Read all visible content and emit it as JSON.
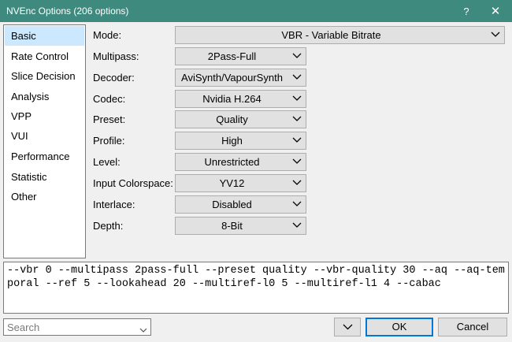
{
  "window": {
    "title": "NVEnc Options (206 options)",
    "help_glyph": "?",
    "close_glyph": "✕",
    "titlebar_color": "#3f8a7f"
  },
  "sidebar": {
    "items": [
      {
        "label": "Basic",
        "selected": true
      },
      {
        "label": "Rate Control"
      },
      {
        "label": "Slice Decision"
      },
      {
        "label": "Analysis"
      },
      {
        "label": "VPP"
      },
      {
        "label": "VUI"
      },
      {
        "label": "Performance"
      },
      {
        "label": "Statistic"
      },
      {
        "label": "Other"
      }
    ],
    "selected_color": "#cce8ff"
  },
  "options": [
    {
      "label": "Mode:",
      "value": "VBR - Variable Bitrate"
    },
    {
      "label": "Multipass:",
      "value": "2Pass-Full"
    },
    {
      "label": "Decoder:",
      "value": "AviSynth/VapourSynth"
    },
    {
      "label": "Codec:",
      "value": "Nvidia H.264"
    },
    {
      "label": "Preset:",
      "value": "Quality"
    },
    {
      "label": "Profile:",
      "value": "High"
    },
    {
      "label": "Level:",
      "value": "Unrestricted"
    },
    {
      "label": "Input Colorspace:",
      "value": "YV12"
    },
    {
      "label": "Interlace:",
      "value": "Disabled"
    },
    {
      "label": "Depth:",
      "value": "8-Bit"
    }
  ],
  "command_line": "--vbr 0 --multipass 2pass-full --preset quality --vbr-quality 30 --aq --aq-temporal --ref 5 --lookahead 20 --multiref-l0 5 --multiref-l1 4 --cabac",
  "search": {
    "placeholder": "Search",
    "value": ""
  },
  "buttons": {
    "ok": "OK",
    "cancel": "Cancel"
  }
}
